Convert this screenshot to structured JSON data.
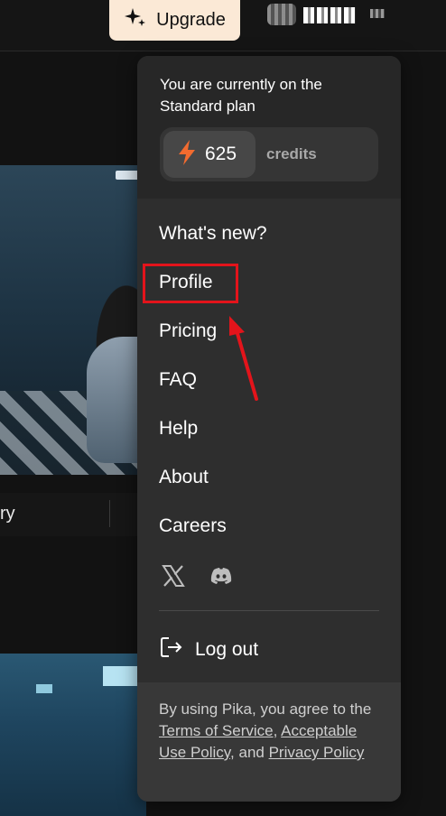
{
  "header": {
    "upgrade_label": "Upgrade",
    "upgrade_icon": "sparkle-icon"
  },
  "feed": {
    "caption_fragment": "ry"
  },
  "menu": {
    "plan_text": "You are currently on the Standard plan",
    "credits": {
      "count": "625",
      "label": "credits",
      "icon": "lightning-icon",
      "icon_color": "#f26b2f"
    },
    "items": [
      {
        "label": "What's new?"
      },
      {
        "label": "Profile"
      },
      {
        "label": "Pricing"
      },
      {
        "label": "FAQ"
      },
      {
        "label": "Help"
      },
      {
        "label": "About"
      },
      {
        "label": "Careers"
      }
    ],
    "social": [
      "x-icon",
      "discord-icon"
    ],
    "logout_label": "Log out",
    "footer": {
      "prefix": "By using Pika, you agree to the ",
      "terms_link": "Terms of Service",
      "comma": ",",
      "aup_link": "Acceptable Use Policy",
      "and": ", and",
      "privacy_link": "Privacy Policy"
    }
  },
  "annotation": {
    "highlight_color": "#e3141b"
  }
}
